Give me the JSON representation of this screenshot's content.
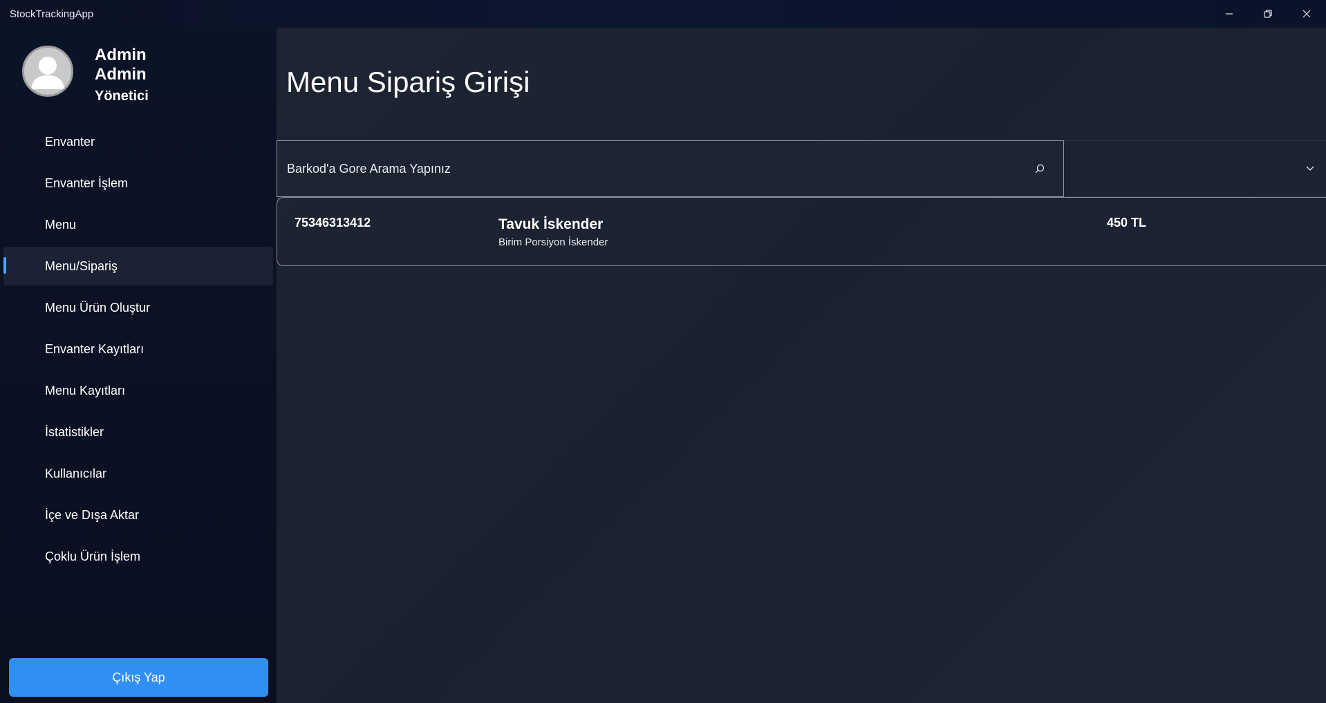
{
  "window": {
    "title": "StockTrackingApp",
    "controls": [
      "minimize-icon",
      "restore-icon",
      "close-icon"
    ]
  },
  "user": {
    "first_name": "Admin",
    "last_name": "Admin",
    "role": "Yönetici",
    "avatar_icon": "user-avatar-icon"
  },
  "sidebar": {
    "items": [
      {
        "label": "Envanter",
        "active": false
      },
      {
        "label": "Envanter İşlem",
        "active": false
      },
      {
        "label": "Menu",
        "active": false
      },
      {
        "label": "Menu/Sipariş",
        "active": true
      },
      {
        "label": "Menu Ürün Oluştur",
        "active": false
      },
      {
        "label": "Envanter Kayıtları",
        "active": false
      },
      {
        "label": "Menu Kayıtları",
        "active": false
      },
      {
        "label": "İstatistikler",
        "active": false
      },
      {
        "label": "Kullanıcılar",
        "active": false
      },
      {
        "label": "İçe ve Dışa Aktar",
        "active": false
      },
      {
        "label": "Çoklu Ürün İşlem",
        "active": false
      }
    ],
    "logout_label": "Çıkış Yap"
  },
  "main": {
    "title": "Menu Sipariş Girişi",
    "search": {
      "placeholder": "Barkod'a Gore Arama Yapınız",
      "value": "",
      "icon": "search-icon"
    },
    "dropdown": {
      "selected": "",
      "icon": "chevron-down-icon"
    },
    "results": [
      {
        "barcode": "75346313412",
        "name": "Tavuk İskender",
        "description": "Birim Porsiyon İskender",
        "price": "450 TL"
      }
    ]
  },
  "colors": {
    "accent": "#2f8ff2",
    "active_indicator": "#4aa3ff",
    "sidebar_bg": "#0b1326",
    "main_bg": "#1e2431",
    "border": "#8e95a3"
  }
}
